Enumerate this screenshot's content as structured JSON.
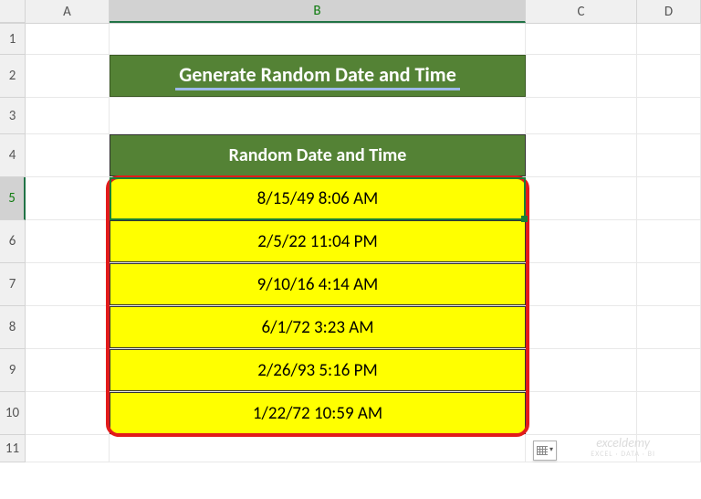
{
  "columns": {
    "A": "A",
    "B": "B",
    "C": "C",
    "D": "D"
  },
  "rows": {
    "1": "1",
    "2": "2",
    "3": "3",
    "4": "4",
    "5": "5",
    "6": "6",
    "7": "7",
    "8": "8",
    "9": "9",
    "10": "10",
    "11": "11"
  },
  "title": "Generate Random Date and Time",
  "header": "Random Date and Time",
  "data": [
    "8/15/49 8:06 AM",
    "2/5/22 11:04 PM",
    "9/10/16 4:14 AM",
    "6/1/72 3:23 AM",
    "2/26/93 5:16 PM",
    "1/22/72 10:59 AM"
  ],
  "watermark": {
    "main": "exceldemy",
    "sub": "EXCEL · DATA · BI"
  },
  "selected": {
    "col": "B",
    "row": "5"
  }
}
